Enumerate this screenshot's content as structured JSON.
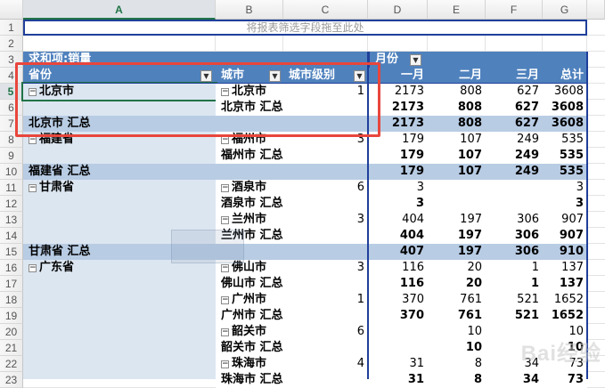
{
  "columns": [
    "A",
    "B",
    "C",
    "D",
    "E",
    "F",
    "G"
  ],
  "selected_column": "A",
  "selected_row": 5,
  "drop_zone": "将报表筛选字段拖至此处",
  "pivot": {
    "value_label": "求和项:销量",
    "column_field": "月份",
    "headers": {
      "province": "省份",
      "city": "城市",
      "city_level": "城市级别",
      "m1": "一月",
      "m2": "二月",
      "m3": "三月",
      "total": "总计"
    }
  },
  "rows": [
    {
      "n": 1
    },
    {
      "n": 2
    },
    {
      "n": 3
    },
    {
      "n": 4
    },
    {
      "n": 5,
      "kind": "detail",
      "province": "北京市",
      "city": "北京市",
      "level": "1",
      "m1": "2173",
      "m2": "808",
      "m3": "627",
      "total": "3608"
    },
    {
      "n": 6,
      "kind": "citysub",
      "city": "北京市 汇总",
      "m1": "2173",
      "m2": "808",
      "m3": "627",
      "total": "3608"
    },
    {
      "n": 7,
      "kind": "provsub",
      "province": "北京市 汇总",
      "m1": "2173",
      "m2": "808",
      "m3": "627",
      "total": "3608"
    },
    {
      "n": 8,
      "kind": "detail",
      "province": "福建省",
      "city": "福州市",
      "level": "3",
      "m1": "179",
      "m2": "107",
      "m3": "249",
      "total": "535"
    },
    {
      "n": 9,
      "kind": "citysub",
      "city": "福州市 汇总",
      "m1": "179",
      "m2": "107",
      "m3": "249",
      "total": "535"
    },
    {
      "n": 10,
      "kind": "provsub",
      "province": "福建省 汇总",
      "m1": "179",
      "m2": "107",
      "m3": "249",
      "total": "535"
    },
    {
      "n": 11,
      "kind": "detail",
      "province": "甘肃省",
      "city": "酒泉市",
      "level": "6",
      "m1": "3",
      "m2": "",
      "m3": "",
      "total": "3"
    },
    {
      "n": 12,
      "kind": "citysub",
      "city": "酒泉市 汇总",
      "m1": "3",
      "m2": "",
      "m3": "",
      "total": "3"
    },
    {
      "n": 13,
      "kind": "detail",
      "city": "兰州市",
      "level": "3",
      "m1": "404",
      "m2": "197",
      "m3": "306",
      "total": "907"
    },
    {
      "n": 14,
      "kind": "citysub",
      "city": "兰州市 汇总",
      "m1": "404",
      "m2": "197",
      "m3": "306",
      "total": "907"
    },
    {
      "n": 15,
      "kind": "provsub",
      "province": "甘肃省 汇总",
      "m1": "407",
      "m2": "197",
      "m3": "306",
      "total": "910"
    },
    {
      "n": 16,
      "kind": "detail",
      "province": "广东省",
      "city": "佛山市",
      "level": "3",
      "m1": "116",
      "m2": "20",
      "m3": "1",
      "total": "137"
    },
    {
      "n": 17,
      "kind": "citysub",
      "city": "佛山市 汇总",
      "m1": "116",
      "m2": "20",
      "m3": "1",
      "total": "137"
    },
    {
      "n": 18,
      "kind": "detail",
      "city": "广州市",
      "level": "1",
      "m1": "370",
      "m2": "761",
      "m3": "521",
      "total": "1652"
    },
    {
      "n": 19,
      "kind": "citysub",
      "city": "广州市 汇总",
      "m1": "370",
      "m2": "761",
      "m3": "521",
      "total": "1652"
    },
    {
      "n": 20,
      "kind": "detail",
      "city": "韶关市",
      "level": "6",
      "m1": "",
      "m2": "10",
      "m3": "",
      "total": "10"
    },
    {
      "n": 21,
      "kind": "citysub",
      "city": "韶关市 汇总",
      "m1": "",
      "m2": "10",
      "m3": "",
      "total": "10"
    },
    {
      "n": 22,
      "kind": "detail",
      "city": "珠海市",
      "level": "4",
      "m1": "31",
      "m2": "8",
      "m3": "34",
      "total": "73"
    },
    {
      "n": 23,
      "kind": "citysub",
      "city": "珠海市 汇总",
      "m1": "31",
      "m2": "8",
      "m3": "34",
      "total": "73"
    }
  ],
  "watermark": "Bai经验",
  "colors": {
    "accent_green": "#217346",
    "pivot_header_blue": "#4f81bd",
    "subtotal_blue": "#b8cce4",
    "row_area_light": "#dce6f1",
    "highlight_red": "#e8463c"
  }
}
